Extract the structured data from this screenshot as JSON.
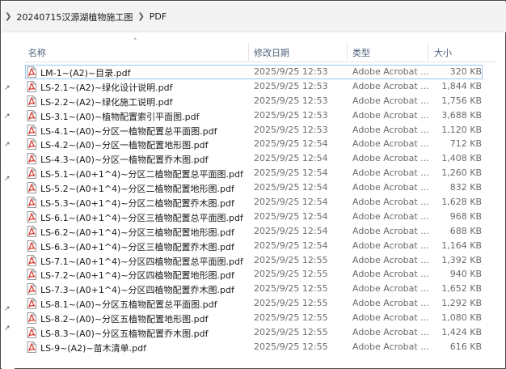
{
  "breadcrumb": {
    "items": [
      "20240715汉源湖植物施工图",
      "PDF"
    ]
  },
  "columns": {
    "name": "名称",
    "date": "修改日期",
    "type": "类型",
    "size": "大小"
  },
  "files": [
    {
      "name": "LM-1~(A2)~目录.pdf",
      "date": "2025/9/25 12:53",
      "type": "Adobe Acrobat ...",
      "size": "320 KB"
    },
    {
      "name": "LS-2.1~(A2)~绿化设计说明.pdf",
      "date": "2025/9/25 12:53",
      "type": "Adobe Acrobat ...",
      "size": "1,844 KB"
    },
    {
      "name": "LS-2.2~(A2)~绿化施工说明.pdf",
      "date": "2025/9/25 12:53",
      "type": "Adobe Acrobat ...",
      "size": "1,756 KB"
    },
    {
      "name": "LS-3.1~(A0)~植物配置索引平面图.pdf",
      "date": "2025/9/25 12:53",
      "type": "Adobe Acrobat ...",
      "size": "3,688 KB"
    },
    {
      "name": "LS-4.1~(A0)~分区一植物配置总平面图.pdf",
      "date": "2025/9/25 12:53",
      "type": "Adobe Acrobat ...",
      "size": "1,120 KB"
    },
    {
      "name": "LS-4.2~(A0)~分区一植物配置地形图.pdf",
      "date": "2025/9/25 12:54",
      "type": "Adobe Acrobat ...",
      "size": "712 KB"
    },
    {
      "name": "LS-4.3~(A0)~分区一植物配置乔木图.pdf",
      "date": "2025/9/25 12:54",
      "type": "Adobe Acrobat ...",
      "size": "1,408 KB"
    },
    {
      "name": "LS-5.1~(A0+1^4)~分区二植物配置总平面图.pdf",
      "date": "2025/9/25 12:54",
      "type": "Adobe Acrobat ...",
      "size": "1,260 KB"
    },
    {
      "name": "LS-5.2~(A0+1^4)~分区二植物配置地形图.pdf",
      "date": "2025/9/25 12:54",
      "type": "Adobe Acrobat ...",
      "size": "832 KB"
    },
    {
      "name": "LS-5.3~(A0+1^4)~分区二植物配置乔木图.pdf",
      "date": "2025/9/25 12:54",
      "type": "Adobe Acrobat ...",
      "size": "1,628 KB"
    },
    {
      "name": "LS-6.1~(A0+1^4)~分区三植物配置总平面图.pdf",
      "date": "2025/9/25 12:54",
      "type": "Adobe Acrobat ...",
      "size": "968 KB"
    },
    {
      "name": "LS-6.2~(A0+1^4)~分区三植物配置地形图.pdf",
      "date": "2025/9/25 12:54",
      "type": "Adobe Acrobat ...",
      "size": "688 KB"
    },
    {
      "name": "LS-6.3~(A0+1^4)~分区三植物配置乔木图.pdf",
      "date": "2025/9/25 12:54",
      "type": "Adobe Acrobat ...",
      "size": "1,164 KB"
    },
    {
      "name": "LS-7.1~(A0+1^4)~分区四植物配置总平面图.pdf",
      "date": "2025/9/25 12:55",
      "type": "Adobe Acrobat ...",
      "size": "1,392 KB"
    },
    {
      "name": "LS-7.2~(A0+1^4)~分区四植物配置地形图.pdf",
      "date": "2025/9/25 12:55",
      "type": "Adobe Acrobat ...",
      "size": "940 KB"
    },
    {
      "name": "LS-7.3~(A0+1^4)~分区四植物配置乔木图.pdf",
      "date": "2025/9/25 12:55",
      "type": "Adobe Acrobat ...",
      "size": "1,652 KB"
    },
    {
      "name": "LS-8.1~(A0)~分区五植物配置总平面图.pdf",
      "date": "2025/9/25 12:55",
      "type": "Adobe Acrobat ...",
      "size": "1,292 KB"
    },
    {
      "name": "LS-8.2~(A0)~分区五植物配置地形图.pdf",
      "date": "2025/9/25 12:55",
      "type": "Adobe Acrobat ...",
      "size": "1,080 KB"
    },
    {
      "name": "LS-8.3~(A0)~分区五植物配置乔木图.pdf",
      "date": "2025/9/25 12:55",
      "type": "Adobe Acrobat ...",
      "size": "1,424 KB"
    },
    {
      "name": "LS-9~(A2)~苗木清单.pdf",
      "date": "2025/9/25 12:55",
      "type": "Adobe Acrobat ...",
      "size": "616 KB"
    }
  ],
  "icons": {
    "file_icon": "pdf-file-icon",
    "pin_icon": "pin-icon"
  },
  "colors": {
    "header_text": "#4c607a",
    "selection_border": "#99c8f0",
    "pdf_red": "#d9342b"
  },
  "selected_index": 0
}
